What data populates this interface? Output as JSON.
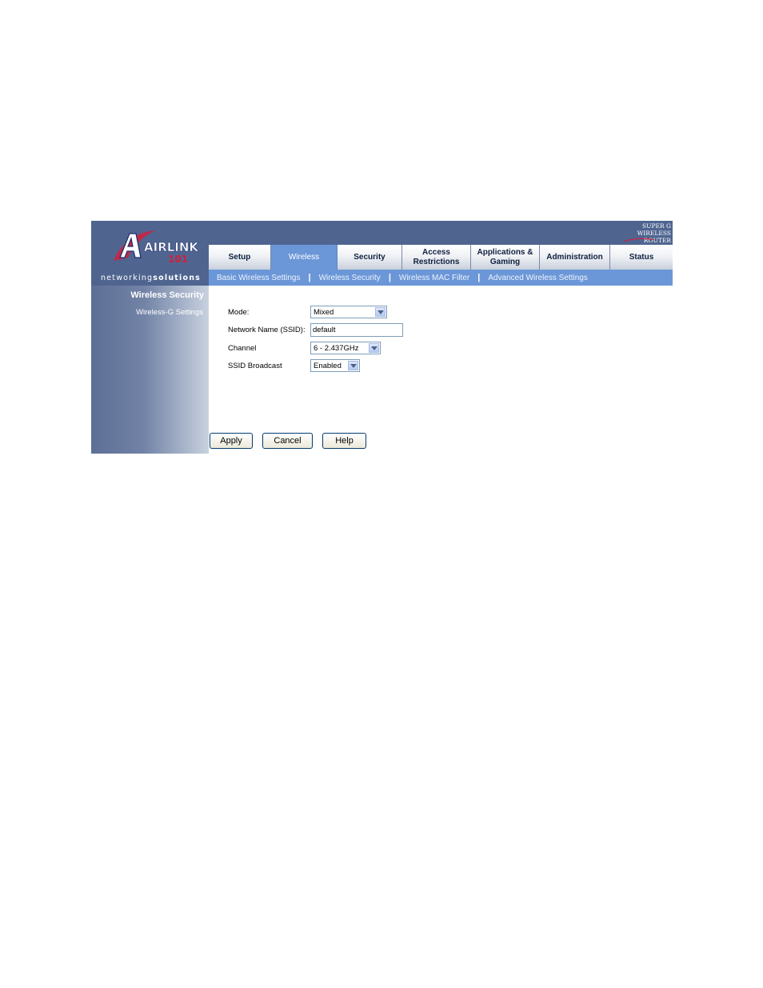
{
  "brand": {
    "logo_text": "AIRLINK",
    "logo_number": "101",
    "tagline_regular": "networking",
    "tagline_bold": "solutions"
  },
  "product_badge": {
    "line1": "SUPER G",
    "line2": "WIRELESS ROUTER"
  },
  "tabs": [
    {
      "label": "Setup"
    },
    {
      "label": "Wireless",
      "active": true
    },
    {
      "label": "Security"
    },
    {
      "label": "Access\nRestrictions"
    },
    {
      "label": "Applications &\nGaming"
    },
    {
      "label": "Administration"
    },
    {
      "label": "Status"
    }
  ],
  "subnav": [
    {
      "label": "Basic Wireless Settings"
    },
    {
      "label": "Wireless Security"
    },
    {
      "label": "Wireless MAC Filter"
    },
    {
      "label": "Advanced Wireless Settings"
    }
  ],
  "sidebar": {
    "title": "Wireless Security",
    "subtitle": "Wireless-G Settings"
  },
  "form": {
    "mode": {
      "label": "Mode:",
      "value": "Mixed"
    },
    "ssid": {
      "label": "Network Name (SSID):",
      "value": "default"
    },
    "channel": {
      "label": "Channel",
      "value": "6 - 2.437GHz"
    },
    "broadcast": {
      "label": "SSID Broadcast",
      "value": "Enabled"
    }
  },
  "buttons": {
    "apply": "Apply",
    "cancel": "Cancel",
    "help": "Help"
  },
  "colors": {
    "header": "#4f6590",
    "active_tab": "#6b97d8",
    "logo_red": "#d21f3c"
  },
  "icons": [
    "dropdown-arrow-icon",
    "airlink-logo",
    "swoosh-icon"
  ]
}
